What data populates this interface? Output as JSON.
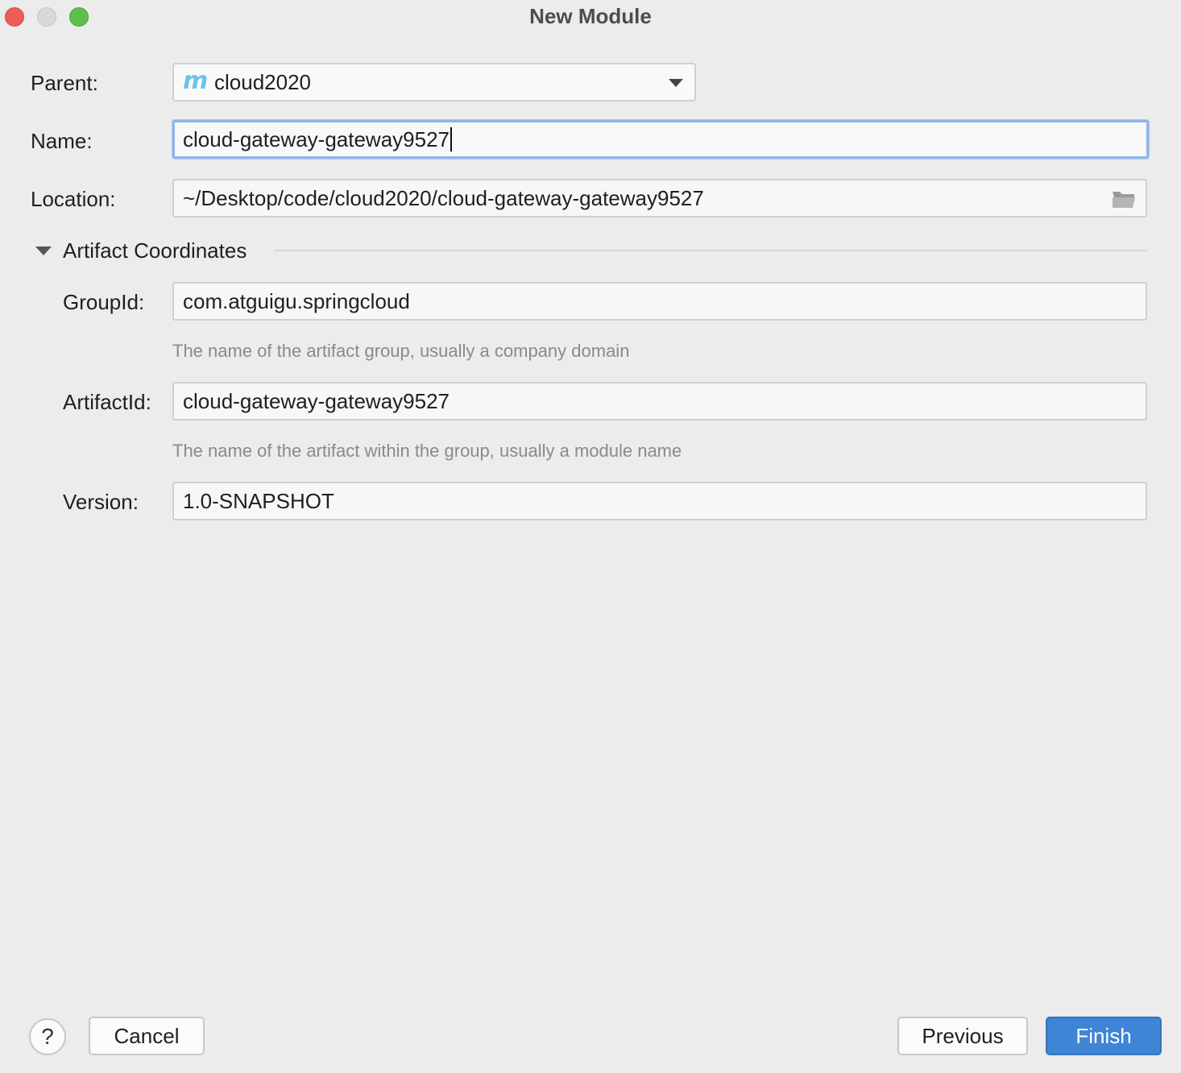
{
  "window": {
    "title": "New Module"
  },
  "form": {
    "parent": {
      "label": "Parent:",
      "icon": "maven-m-icon",
      "value": "cloud2020"
    },
    "name": {
      "label": "Name:",
      "value": "cloud-gateway-gateway9527"
    },
    "location": {
      "label": "Location:",
      "value": "~/Desktop/code/cloud2020/cloud-gateway-gateway9527",
      "icon": "folder-icon"
    }
  },
  "artifact": {
    "section_title": "Artifact Coordinates",
    "group_id": {
      "label": "GroupId:",
      "value": "com.atguigu.springcloud",
      "hint": "The name of the artifact group, usually a company domain"
    },
    "artifact_id": {
      "label": "ArtifactId:",
      "value": "cloud-gateway-gateway9527",
      "hint": "The name of the artifact within the group, usually a module name"
    },
    "version": {
      "label": "Version:",
      "value": "1.0-SNAPSHOT"
    }
  },
  "footer": {
    "help_label": "?",
    "cancel_label": "Cancel",
    "previous_label": "Previous",
    "finish_label": "Finish"
  },
  "colors": {
    "accent": "#3f85d6",
    "focus_ring": "#8fb4e9",
    "close": "#ec5f57",
    "maximize": "#5ec04a"
  }
}
